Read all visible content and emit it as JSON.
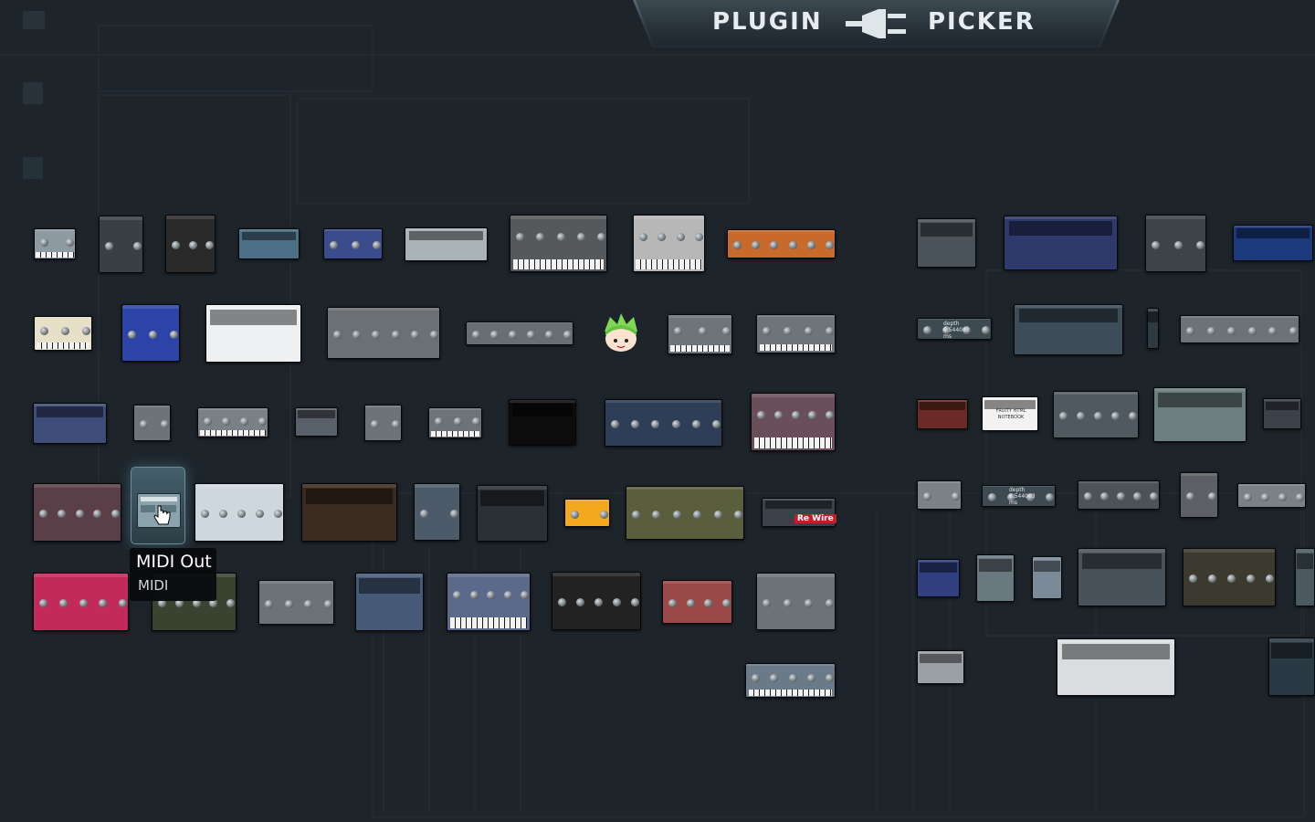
{
  "header": {
    "word_left": "PLUGIN",
    "word_right": "PICKER",
    "icon": "plug-icon"
  },
  "tooltip": {
    "plugin_name": "MIDI Out",
    "category": "MIDI"
  },
  "rewire_label": "Re Wire",
  "notebook_label": "FRUITY HTML NOTEBOOK",
  "depth_widget": {
    "label": "depth",
    "value": "6.544003",
    "unit": "ms"
  },
  "colors": {
    "background": "#1d252b",
    "header_text": "#e6ecef",
    "selection_glow": "#78bed7",
    "tooltip_bg": "#080a0c"
  },
  "plugins_count_visible": 84
}
